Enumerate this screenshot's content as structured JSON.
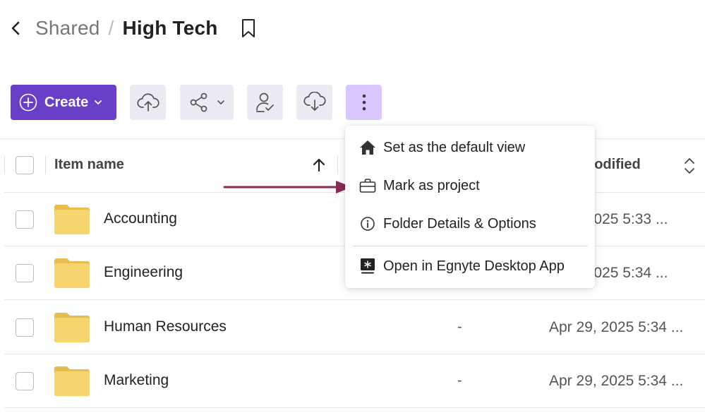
{
  "breadcrumb": {
    "parent": "Shared",
    "separator": "/",
    "current": "High Tech"
  },
  "toolbar": {
    "create_label": "Create",
    "buttons": [
      "upload-icon",
      "share-icon",
      "user-permissions-icon",
      "download-icon",
      "more-icon"
    ]
  },
  "table": {
    "headers": {
      "name": "Item name",
      "modified": "nodified"
    },
    "rows": [
      {
        "name": "Accounting",
        "size": "",
        "modified": ", 2025 5:33 ..."
      },
      {
        "name": "Engineering",
        "size": "",
        "modified": ", 2025 5:34 ..."
      },
      {
        "name": "Human Resources",
        "size": "-",
        "modified": "Apr 29, 2025 5:34 ..."
      },
      {
        "name": "Marketing",
        "size": "-",
        "modified": "Apr 29, 2025 5:34 ..."
      }
    ]
  },
  "menu": {
    "items": [
      {
        "label": "Set as the default view",
        "icon": "home-icon"
      },
      {
        "label": "Mark as project",
        "icon": "briefcase-icon"
      },
      {
        "label": "Folder Details & Options",
        "icon": "info-icon"
      },
      {
        "label": "Open in Egnyte Desktop App",
        "icon": "egnyte-desktop-icon"
      }
    ]
  },
  "colors": {
    "primary": "#6a3fc8",
    "toolbar_bg": "#ecebf4",
    "active_bg": "#d9c8ff",
    "folder": "#f5d06b",
    "arrow": "#8b2a52"
  }
}
